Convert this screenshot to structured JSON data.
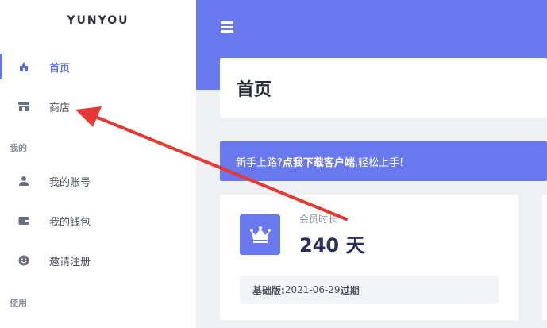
{
  "brand": "YUNYOU",
  "nav": {
    "home": "首页",
    "shop": "商店",
    "section_mine": "我的",
    "account": "我的账号",
    "wallet": "我的钱包",
    "invite": "邀请注册",
    "section_use": "使用"
  },
  "page": {
    "title": "首页"
  },
  "banner": {
    "prefix": "新手上路?",
    "link": "点我下载客户端",
    "suffix": ",轻松上手!"
  },
  "membership": {
    "label": "会员时长",
    "value": "240 天",
    "plan_name": "基础版:",
    "plan_date": " 2021-06-29 ",
    "plan_status": "过期"
  },
  "colors": {
    "accent": "#6a78ee",
    "annotation_arrow": "#e53935"
  }
}
